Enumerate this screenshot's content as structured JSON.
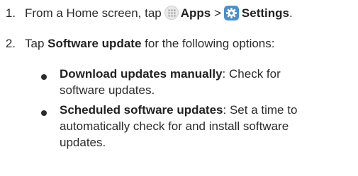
{
  "step1": {
    "number": "1.",
    "text_before": "From a Home screen, tap",
    "apps_label": "Apps",
    "separator": ">",
    "settings_label": "Settings",
    "end": "."
  },
  "step2": {
    "number": "2.",
    "text_before": "Tap",
    "bold": "Software update",
    "text_after": "for the following options:"
  },
  "bullets": [
    {
      "title": "Download updates manually",
      "colon": ":",
      "line1": "Check for",
      "line2": "software updates."
    },
    {
      "title": "Scheduled software updates",
      "colon": ":",
      "line1": "Set a time to",
      "line2": "automatically check for and install software",
      "line3": "updates."
    }
  ],
  "icons": {
    "apps": "apps-grid-icon",
    "settings": "settings-gear-icon",
    "settings_color": "#4a90c9"
  }
}
